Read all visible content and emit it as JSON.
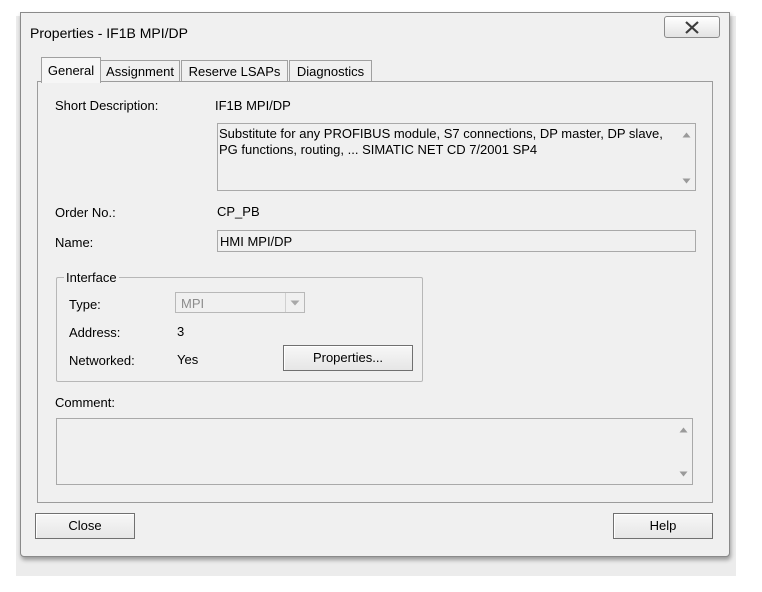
{
  "window": {
    "title": "Properties - IF1B MPI/DP"
  },
  "tabs": [
    {
      "label": "General"
    },
    {
      "label": "Assignment"
    },
    {
      "label": "Reserve LSAPs"
    },
    {
      "label": "Diagnostics"
    }
  ],
  "general": {
    "short_description_label": "Short Description:",
    "short_description_value": "IF1B MPI/DP",
    "description_text": "Substitute for any PROFIBUS module, S7 connections, DP master, DP slave, PG functions, routing, ... SIMATIC NET CD 7/2001 SP4",
    "order_no_label": "Order No.:",
    "order_no_value": "CP_PB",
    "name_label": "Name:",
    "name_value": "HMI MPI/DP",
    "interface": {
      "legend": "Interface",
      "type_label": "Type:",
      "type_value": "MPI",
      "address_label": "Address:",
      "address_value": "3",
      "networked_label": "Networked:",
      "networked_value": "Yes",
      "properties_button": "Properties..."
    },
    "comment_label": "Comment:",
    "comment_value": ""
  },
  "footer": {
    "close_button": "Close",
    "help_button": "Help"
  },
  "icons": {
    "close": "close-icon",
    "dropdown": "chevron-down-icon",
    "scroll_up": "scroll-up-arrow-icon",
    "scroll_down": "scroll-down-arrow-icon"
  },
  "colors": {
    "dialog_bg": "#f0f0f0",
    "border": "#8a8a8a",
    "disabled_text": "#8c8c8c"
  }
}
